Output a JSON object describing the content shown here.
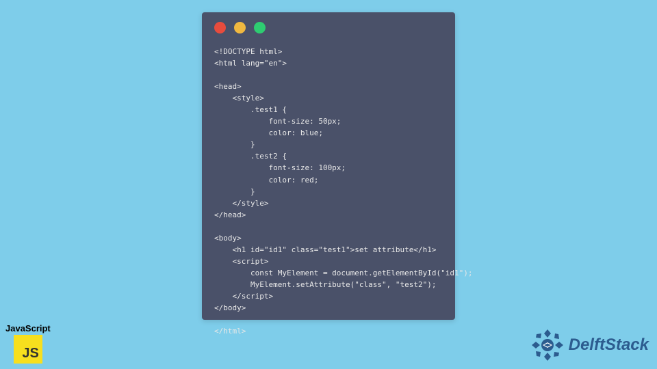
{
  "code": {
    "lines": [
      "<!DOCTYPE html>",
      "<html lang=\"en\">",
      "",
      "<head>",
      "    <style>",
      "        .test1 {",
      "            font-size: 50px;",
      "            color: blue;",
      "        }",
      "        .test2 {",
      "            font-size: 100px;",
      "            color: red;",
      "        }",
      "    </style>",
      "</head>",
      "",
      "<body>",
      "    <h1 id=\"id1\" class=\"test1\">set attribute</h1>",
      "    <script>",
      "        const MyElement = document.getElementById(\"id1\");",
      "        MyElement.setAttribute(\"class\", \"test2\");",
      "    </script>",
      "</body>",
      "",
      "</html>"
    ]
  },
  "badges": {
    "js_label": "JavaScript",
    "js_logo_text": "JS",
    "delftstack": "DelftStack"
  },
  "colors": {
    "bg": "#7ecdea",
    "window": "#4a5169",
    "js_yellow": "#F7DF1E",
    "ds_brand": "#2c5c8f"
  }
}
